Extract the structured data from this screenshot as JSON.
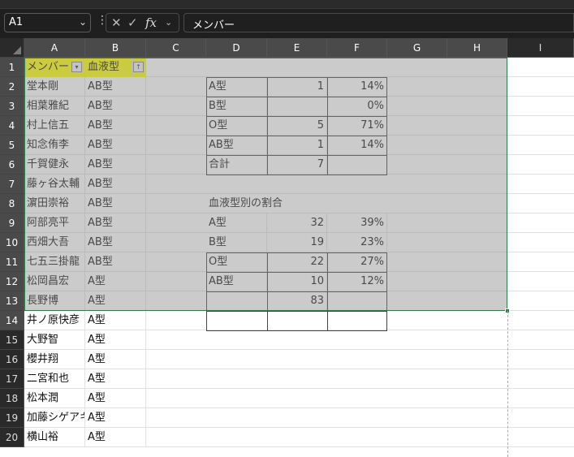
{
  "formula_bar": {
    "name_box": "A1",
    "content": "メンバー"
  },
  "columns": [
    "A",
    "B",
    "C",
    "D",
    "E",
    "F",
    "G",
    "H",
    "I"
  ],
  "rows": [
    "1",
    "2",
    "3",
    "4",
    "5",
    "6",
    "7",
    "8",
    "9",
    "10",
    "11",
    "12",
    "13",
    "14",
    "15",
    "16",
    "17",
    "18",
    "19",
    "20"
  ],
  "cells": {
    "A": [
      "メンバー",
      "堂本剛",
      "相葉雅紀",
      "村上信五",
      "知念侑李",
      "千賀健永",
      "藤ヶ谷太輔",
      "濵田崇裕",
      "阿部亮平",
      "西畑大吾",
      "七五三掛龍",
      "松岡昌宏",
      "長野博",
      "井ノ原快彦",
      "大野智",
      "櫻井翔",
      "二宮和也",
      "松本潤",
      "加藤シゲアキ",
      "横山裕"
    ],
    "B": [
      "血液型",
      "AB型",
      "AB型",
      "AB型",
      "AB型",
      "AB型",
      "AB型",
      "AB型",
      "AB型",
      "AB型",
      "AB型",
      "A型",
      "A型",
      "A型",
      "A型",
      "A型",
      "A型",
      "A型",
      "A型",
      "A型"
    ],
    "D": [
      "",
      "A型",
      "B型",
      "O型",
      "AB型",
      "合計",
      "",
      "血液型別の割合",
      "A型",
      "B型",
      "O型",
      "AB型",
      "",
      "",
      "",
      "",
      "",
      "",
      "",
      ""
    ],
    "E": [
      "",
      "1",
      "",
      "5",
      "1",
      "7",
      "",
      "",
      "32",
      "19",
      "22",
      "10",
      "83",
      "",
      "",
      "",
      "",
      "",
      "",
      ""
    ],
    "F": [
      "",
      "14%",
      "0%",
      "71%",
      "14%",
      "",
      "",
      "",
      "39%",
      "23%",
      "27%",
      "12%",
      "",
      "",
      "",
      "",
      "",
      "",
      "",
      ""
    ]
  },
  "colors": {
    "header_highlight": "#ffff00",
    "selection_border": "#2e7d4a"
  },
  "icons": {
    "filter_a": "filter-dropdown-icon",
    "filter_b": "sort-ascending-filter-icon"
  }
}
